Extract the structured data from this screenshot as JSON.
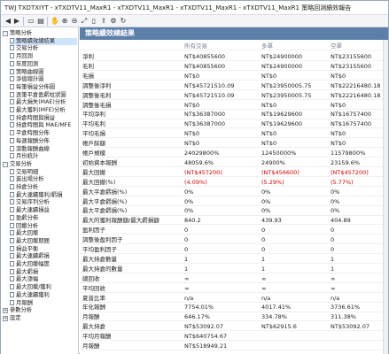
{
  "window": {
    "title": "TWJ TXDTXIYT - xTXDTV11_MaxR1 - xTXDTV11_MaxR1 - xTXDTV11_MaxR1 - xTXDTV11_MaxR1 策略回測績效報告"
  },
  "toolbar": {
    "icons": [
      "back-icon",
      "forward-icon",
      "copy-icon",
      "print-icon",
      "pan-icon",
      "zoom-in-icon",
      "zoom-out-icon",
      "fit-icon",
      "page-icon",
      "export-icon",
      "settings-icon",
      "refresh-icon"
    ]
  },
  "tree": {
    "nodes": [
      {
        "label": "策略分析",
        "level": 0,
        "expander": "-"
      },
      {
        "label": "策略績效總結果",
        "level": 1
      },
      {
        "label": "交易分析",
        "level": 1
      },
      {
        "label": "月回測",
        "level": 1
      },
      {
        "label": "年度回測",
        "level": 1
      },
      {
        "label": "策略曲線圖",
        "level": 1
      },
      {
        "label": "淨值總計圖",
        "level": 1
      },
      {
        "label": "每筆損益分佈圖",
        "level": 1
      },
      {
        "label": "逐筆平倉盈虧柱狀圖",
        "level": 1
      },
      {
        "label": "最大損失(MAE)分析",
        "level": 1
      },
      {
        "label": "最大獲利(MFE)分析",
        "level": 1
      },
      {
        "label": "持倉時間與損益",
        "level": 1
      },
      {
        "label": "持倉時間與 MAE/MFE",
        "level": 1
      },
      {
        "label": "平倉時間分佈",
        "level": 1
      },
      {
        "label": "每週報酬分佈",
        "level": 1
      },
      {
        "label": "滾動報酬曲線",
        "level": 1
      },
      {
        "label": "月份統計",
        "level": 1
      },
      {
        "label": "交易分析",
        "level": 0,
        "expander": "-"
      },
      {
        "label": "交易明細",
        "level": 1
      },
      {
        "label": "進出場分析",
        "level": 1
      },
      {
        "label": "持倉分析",
        "level": 1
      },
      {
        "label": "最大連續獲利/虧損",
        "level": 1
      },
      {
        "label": "交易序列分析",
        "level": 1
      },
      {
        "label": "最大連續損益",
        "level": 1
      },
      {
        "label": "盈虧分佈",
        "level": 1
      },
      {
        "label": "回撤分析",
        "level": 1
      },
      {
        "label": "最大回撤",
        "level": 1
      },
      {
        "label": "最大回撤期間",
        "level": 1
      },
      {
        "label": "損益平衡",
        "level": 1
      },
      {
        "label": "最大連續虧損",
        "level": 1
      },
      {
        "label": "最大回撤幅度",
        "level": 1
      },
      {
        "label": "最大虧損",
        "level": 1
      },
      {
        "label": "最大漲幅",
        "level": 1
      },
      {
        "label": "最大回撤/獲利",
        "level": 1
      },
      {
        "label": "最大連續獲利",
        "level": 1
      },
      {
        "label": "月報酬",
        "level": 1
      },
      {
        "label": "參數分析",
        "level": 0,
        "expander": "+"
      },
      {
        "label": "設定",
        "level": 0,
        "expander": "+"
      }
    ]
  },
  "report": {
    "header": "策略績效總結果",
    "columns": [
      "",
      "所有交易",
      "多單",
      "空單"
    ],
    "rows": [
      [
        "淨利",
        "NT$40855600",
        "NT$24900000",
        "NT$23155600"
      ],
      [
        "毛利",
        "NT$40855600",
        "NT$24900000",
        "NT$23155600"
      ],
      [
        "毛損",
        "NT$0",
        "NT$0",
        "NT$0"
      ],
      [
        "調整後淨利",
        "NT$45721510.09",
        "NT$23950005.75",
        "NT$22216480.18"
      ],
      [
        "調整後毛利",
        "NT$45721510.09",
        "NT$23950005.75",
        "NT$22216480.18"
      ],
      [
        "調整後毛損",
        "NT$0",
        "NT$0",
        "NT$0"
      ],
      [
        "平均淨利",
        "NT$36387000",
        "NT$19629600",
        "NT$16757400"
      ],
      [
        "平均毛利",
        "NT$36387000",
        "NT$19629600",
        "NT$16757400"
      ],
      [
        "平均毛損",
        "NT$0",
        "NT$0",
        "NT$0"
      ],
      [
        "帳戶餘額",
        "NT$0",
        "NT$0",
        "NT$0"
      ],
      [
        "帳戶規模",
        "24029800%",
        "12450000%",
        "11579800%"
      ],
      [
        "初始資本報酬",
        "48059.6%",
        "24900%",
        "23159.6%"
      ],
      [
        "最大回撤",
        "(NT$457200)",
        "(NT$456600)",
        "(NT$457200)"
      ],
      [
        "最大回撤(%)",
        "(4.09%)",
        "(5.29%)",
        "(5.77%)"
      ],
      [
        "最大平倉虧損(%)",
        "0%",
        "0%",
        "0%"
      ],
      [
        "最大平倉虧損(%)",
        "0%",
        "0%",
        "0%"
      ],
      [
        "最大平倉虧損(%)",
        "0%",
        "0%",
        "0%"
      ],
      [
        "最大的獲利報酬額/最大虧損額",
        "840.2",
        "439.93",
        "404.89"
      ],
      [
        "盈利因子",
        "0",
        "0",
        "0"
      ],
      [
        "調整後盈利因子",
        "0",
        "0",
        "0"
      ],
      [
        "平均盈利因子",
        "0",
        "0",
        "0"
      ],
      [
        "最大持倉數量",
        "1",
        "1",
        "1"
      ],
      [
        "最大持倉的數量",
        "1",
        "1",
        "1"
      ],
      [
        "總回收",
        "∞",
        "∞",
        "∞"
      ],
      [
        "平均回收",
        "∞",
        "∞",
        "∞"
      ],
      [
        "夏普比率",
        "n/a",
        "n/a",
        "n/a"
      ],
      [
        "年化報酬",
        "7754.01%",
        "4017.41%",
        "3736.61%"
      ],
      [
        "月報酬",
        "646.17%",
        "334.78%",
        "311.38%"
      ],
      [
        "最大持倉",
        "NT$53092.07",
        "NT$62915.6",
        "NT$53092.07"
      ],
      [
        "平均月報酬",
        "NT$640754.67",
        "",
        ""
      ],
      [
        "月報酬",
        "NT$518949.21",
        "",
        ""
      ]
    ]
  }
}
